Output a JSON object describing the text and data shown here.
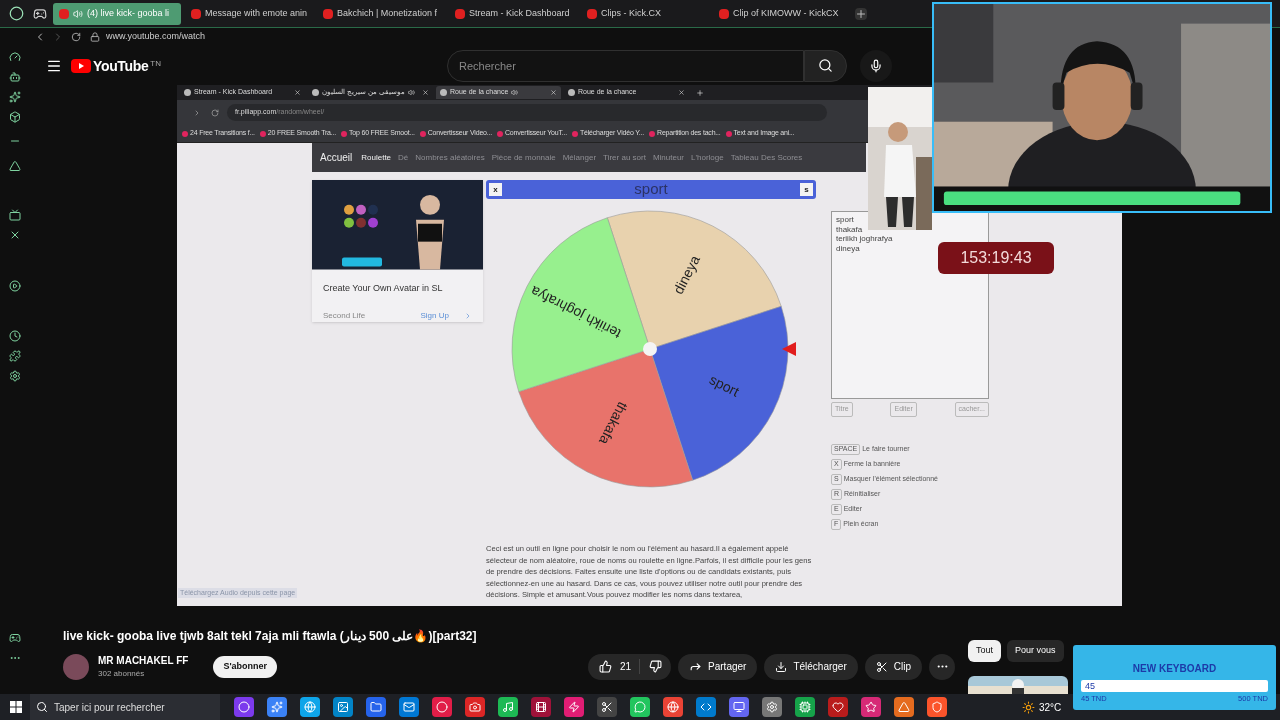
{
  "browser": {
    "tabs": [
      {
        "title": "(4) live kick- gooba li",
        "selected": true,
        "audio": true
      },
      {
        "title": "Message with emote anin",
        "selected": false,
        "audio": false
      },
      {
        "title": "Bakchich | Monetization f",
        "selected": false,
        "audio": false
      },
      {
        "title": "Stream - Kick Dashboard",
        "selected": false,
        "audio": false
      },
      {
        "title": "Clips - Kick.CX",
        "selected": false,
        "audio": false
      },
      {
        "title": "Clip of KIMOWW - KickCX",
        "selected": false,
        "audio": false
      }
    ],
    "address": "www.youtube.com/watch"
  },
  "youtube": {
    "logo": "YouTube",
    "region": "TN",
    "search": {
      "placeholder": "Rechercher"
    }
  },
  "video": {
    "inner_browser": {
      "tabs": [
        {
          "title": "Stream - Kick Dashboard",
          "selected": false,
          "audio": false
        },
        {
          "title": "موسيقى من سيريج السليون",
          "selected": false,
          "audio": true
        },
        {
          "title": "Roue de la chance",
          "selected": true,
          "audio": true
        },
        {
          "title": "Roue de la chance",
          "selected": false,
          "audio": false
        }
      ],
      "address_host": "fr.piliapp.com",
      "address_path": "/random/wheel/",
      "bookmarks": [
        "24 Free Transitions f...",
        "20 FREE Smooth Tra...",
        "Top 60 FREE Smoot...",
        "Convertisseur Video...",
        "Convertisseur YouT...",
        "Télécharger Vidéo Y...",
        "Repartition des tach...",
        "Text and Image ani..."
      ]
    },
    "page": {
      "nav": {
        "home": "Accueil",
        "items": [
          {
            "label": "Roulette",
            "selected": true
          },
          {
            "label": "Dé",
            "selected": false
          },
          {
            "label": "Nombres aléatoires",
            "selected": false
          },
          {
            "label": "Pièce de monnaie",
            "selected": false
          },
          {
            "label": "Mélanger",
            "selected": false
          },
          {
            "label": "Tirer au sort",
            "selected": false
          },
          {
            "label": "Minuteur",
            "selected": false
          },
          {
            "label": "L'horloge",
            "selected": false
          },
          {
            "label": "Tableau Des Scores",
            "selected": false
          }
        ]
      },
      "ad": {
        "kind": "picture",
        "title": "Create Your Own Avatar in SL",
        "advertiser": "Second Life",
        "cta": "Sign Up"
      },
      "banner": {
        "title": "sport",
        "close_key": "x",
        "hide_key": "s"
      },
      "wheel": {
        "segments": [
          {
            "label": "dineya",
            "color": "#e8d2ae"
          },
          {
            "label": "sport",
            "color": "#4a62d8"
          },
          {
            "label": "thakafa",
            "color": "#e8736b"
          },
          {
            "label": "teriikh joghrafya",
            "color": "#97f08e"
          }
        ]
      },
      "textarea": "sport\nthakafa\nteriikh joghrafya\ndineya",
      "buttons": [
        "Titre",
        "Editer",
        "cacher..."
      ],
      "shortcuts": [
        {
          "key": "SPACE",
          "label": "Le faire tourner"
        },
        {
          "key": "X",
          "label": "Ferme la bannière"
        },
        {
          "key": "S",
          "label": "Masquer l'élément sélectionné"
        },
        {
          "key": "R",
          "label": "Réinitialiser"
        },
        {
          "key": "E",
          "label": "Editer"
        },
        {
          "key": "F",
          "label": "Plein écran"
        }
      ],
      "description": "Ceci est un outil en ligne pour choisir le nom ou l'élément au hasard.Il a également appelé sélecteur de nom aléatoire, roue de noms ou roulette en ligne.Parfois, il est difficile pour les gens de prendre des décisions. Faites ensuite une liste d'options ou de candidats existants, puis sélectionnez-en une au hasard. Dans ce cas, vous pouvez utiliser notre outil pour prendre des décisions. Simple et amusant.Vous pouvez modifier les noms dans textarea,",
      "download_bar": "Téléchargez Audio depuis cette page"
    },
    "timer": "153:19:43"
  },
  "title": "live kick- gooba live tjwb 8alt tekl 7aja mli ftawla (على 500 دينار🔥)[part32]",
  "channel": {
    "name": "MR MACHAKEL FF",
    "subscribers": "302 abonnés",
    "subscribe": "S'abonner"
  },
  "actions": {
    "likes": "21",
    "share": "Partager",
    "download": "Télécharger",
    "clip": "Clip"
  },
  "chips": [
    {
      "label": "Tout",
      "selected": true
    },
    {
      "label": "Pour vous",
      "selected": false
    }
  ],
  "widget": {
    "title": "NEW KEYBOARD",
    "value": "45",
    "min": "45 TND",
    "max": "500 TND"
  },
  "taskbar": {
    "search": {
      "placeholder": "Taper ici pour rechercher"
    },
    "weather": "32°C"
  }
}
